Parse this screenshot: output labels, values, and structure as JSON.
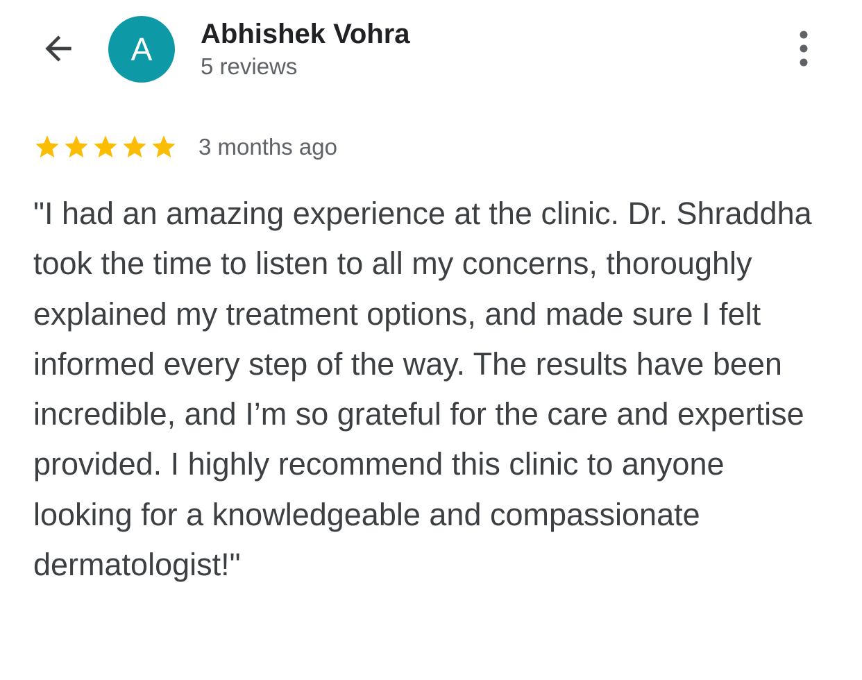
{
  "header": {
    "back_icon": "arrow-left-icon",
    "avatar_letter": "A",
    "avatar_color": "#0d9aa6",
    "user_name": "Abhishek Vohra",
    "review_count": "5 reviews",
    "more_icon": "more-vertical-icon"
  },
  "review": {
    "rating": 5,
    "rating_max": 5,
    "star_color": "#fbbc04",
    "time": "3 months ago",
    "text": "\"I had an amazing experience at the clinic. Dr. Shraddha took the time to listen to all my concerns, thoroughly explained my treatment options, and made sure I felt informed every step of the way. The results have been incredible, and I’m so grateful for the care and expertise provided. I highly recommend this clinic to anyone looking for a knowledgeable and compassionate dermatologist!\""
  }
}
